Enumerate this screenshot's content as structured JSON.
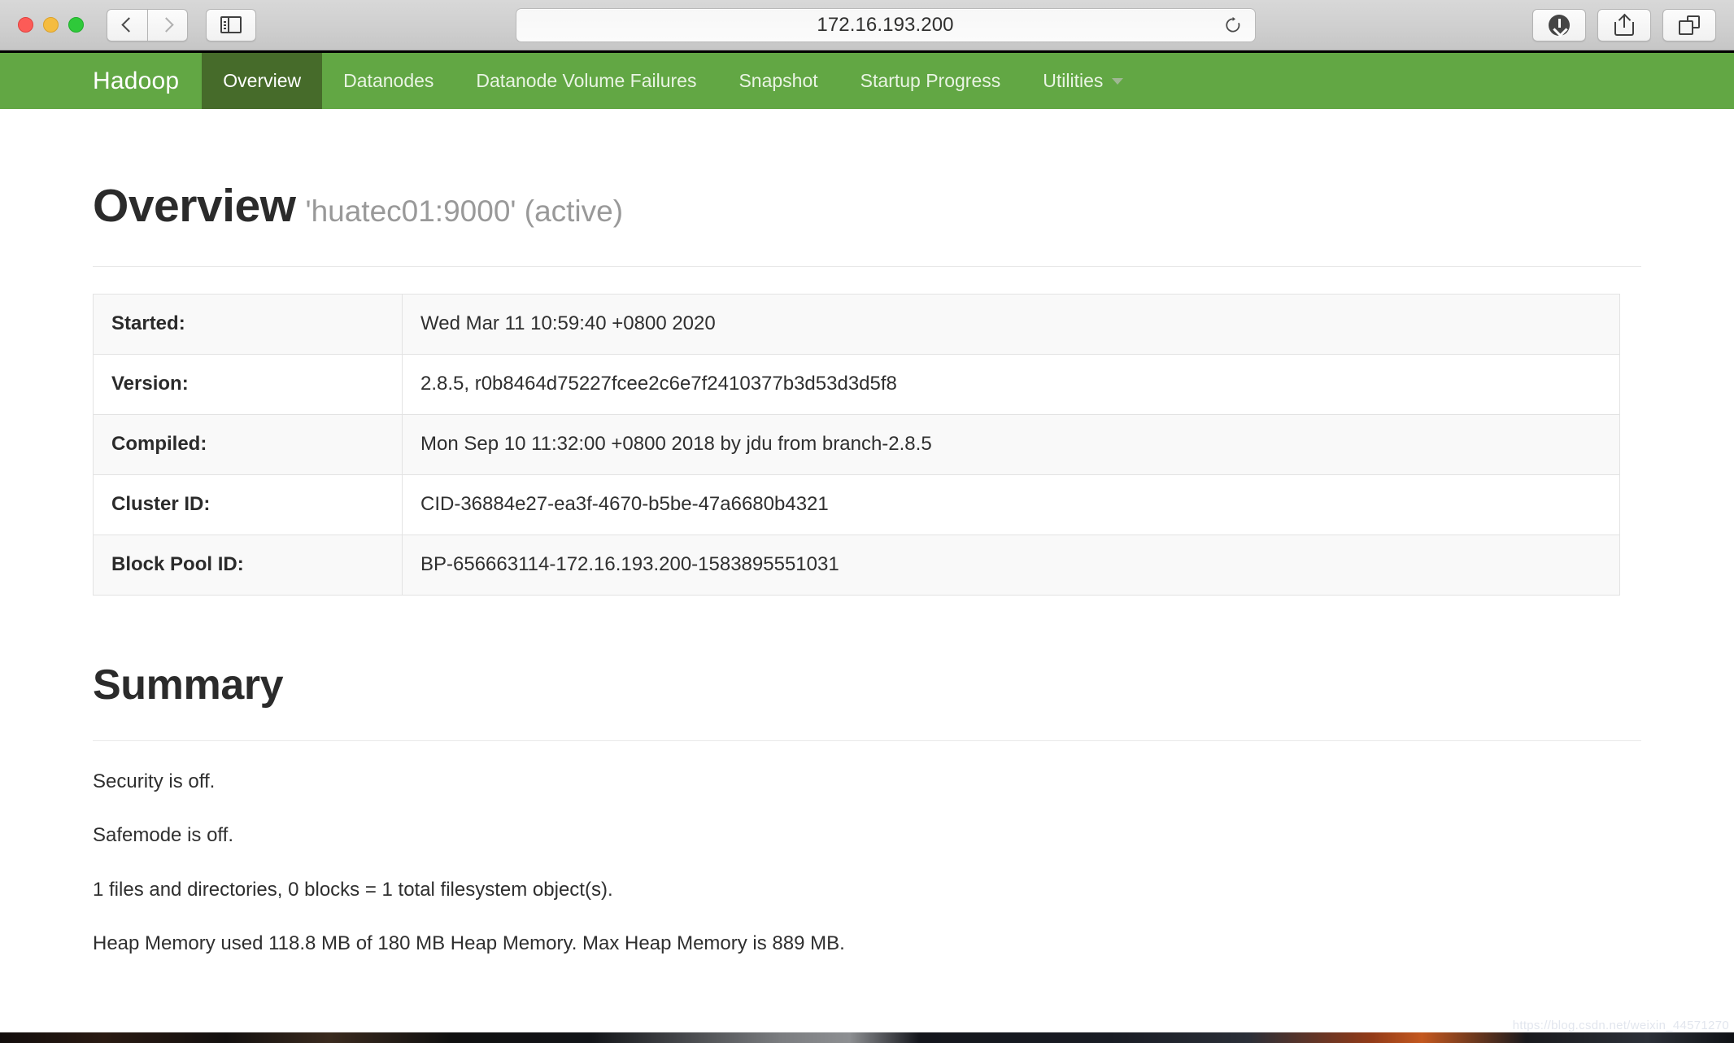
{
  "browser": {
    "url": "172.16.193.200",
    "back_label": "Back",
    "forward_label": "Forward",
    "sidebar_label": "Show Sidebar",
    "reload_label": "Reload",
    "downloads_label": "Downloads",
    "share_label": "Share",
    "tabs_label": "Show Tab Overview"
  },
  "navbar": {
    "brand": "Hadoop",
    "items": [
      {
        "label": "Overview",
        "active": true
      },
      {
        "label": "Datanodes",
        "active": false
      },
      {
        "label": "Datanode Volume Failures",
        "active": false
      },
      {
        "label": "Snapshot",
        "active": false
      },
      {
        "label": "Startup Progress",
        "active": false
      },
      {
        "label": "Utilities",
        "active": false,
        "dropdown": true
      }
    ],
    "colors": {
      "background": "#62a744",
      "active_background": "#466b2a",
      "text": "#e9f4e3"
    }
  },
  "overview": {
    "title": "Overview",
    "host": "'huatec01:9000' (active)",
    "rows": [
      {
        "key": "Started:",
        "value": "Wed Mar 11 10:59:40 +0800 2020"
      },
      {
        "key": "Version:",
        "value": "2.8.5, r0b8464d75227fcee2c6e7f2410377b3d53d3d5f8"
      },
      {
        "key": "Compiled:",
        "value": "Mon Sep 10 11:32:00 +0800 2018 by jdu from branch-2.8.5"
      },
      {
        "key": "Cluster ID:",
        "value": "CID-36884e27-ea3f-4670-b5be-47a6680b4321"
      },
      {
        "key": "Block Pool ID:",
        "value": "BP-656663114-172.16.193.200-1583895551031"
      }
    ]
  },
  "summary": {
    "title": "Summary",
    "lines": [
      "Security is off.",
      "Safemode is off.",
      "1 files and directories, 0 blocks = 1 total filesystem object(s).",
      "Heap Memory used 118.8 MB of 180 MB Heap Memory. Max Heap Memory is 889 MB."
    ]
  },
  "watermark": "https://blog.csdn.net/weixin_44571270"
}
